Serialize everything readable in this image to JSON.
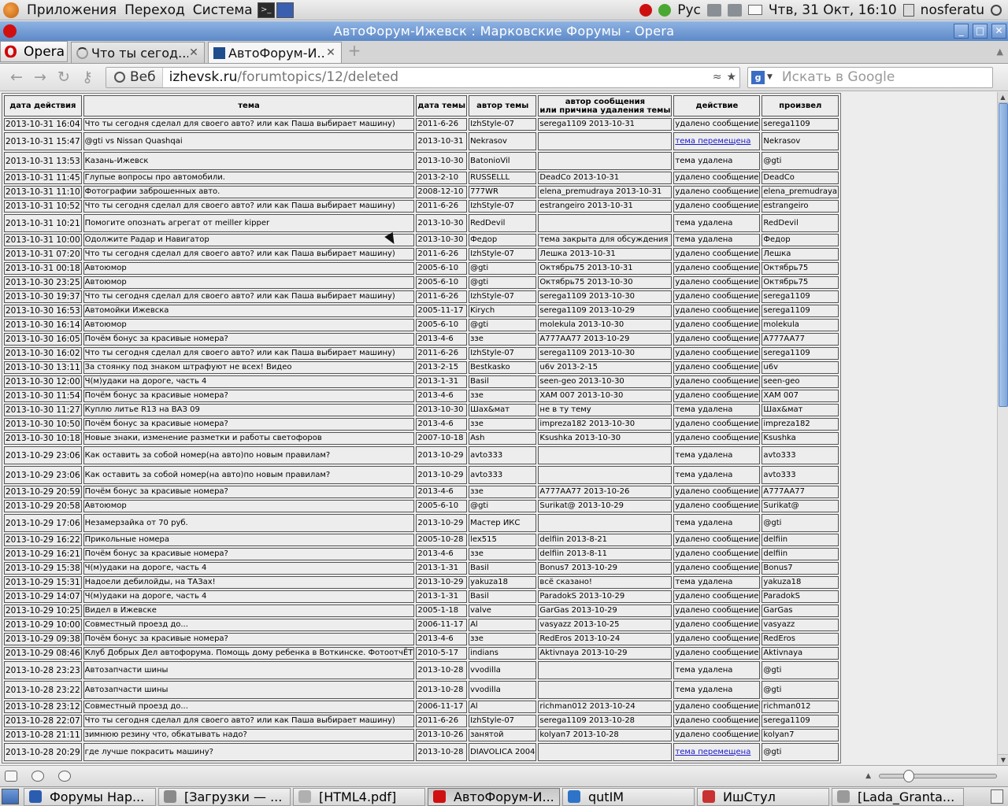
{
  "top_panel": {
    "menus": [
      "Приложения",
      "Переход",
      "Система"
    ],
    "keyboard_layout": "Рус",
    "clock": "Чтв, 31 Окт, 16:10",
    "user": "nosferatu"
  },
  "window": {
    "title": "АвтоФорум-Ижевск : Марковские Форумы - Opera"
  },
  "tabs": {
    "menu_label": "Opera",
    "items": [
      {
        "title": "Что ты сегод...",
        "icon": "loading-icon",
        "active": false
      },
      {
        "title": "АвтоФорум-И...",
        "icon": "forum-icon",
        "active": true
      }
    ]
  },
  "nav": {
    "web_label": "Веб",
    "url_host": "izhevsk.ru",
    "url_path": "/forumtopics/12/deleted",
    "search_placeholder": "Искать в Google"
  },
  "table": {
    "headers": [
      "дата действия",
      "тема",
      "дата темы",
      "автор темы",
      "автор сообщения\nили причина удаления темы",
      "действие",
      "произвел"
    ],
    "rows": [
      [
        "2013-10-31 16:04",
        "Что ты сегодня сделал для своего авто? или как Паша выбирает машину)",
        "2011-6-26",
        "IzhStyle-07",
        "serega1109 2013-10-31",
        "удалено сообщение",
        "serega1109"
      ],
      [
        "2013-10-31 15:47",
        "@gti vs Nissan Quashqai",
        "2013-10-31",
        "Nekrasov",
        "",
        "тема перемещена",
        "Nekrasov"
      ],
      [
        "2013-10-31 13:53",
        "Казань-Ижевск",
        "2013-10-30",
        "BatonioVil",
        "",
        "тема удалена",
        "@gti"
      ],
      [
        "2013-10-31 11:45",
        "Глупые вопросы про автомобили.",
        "2013-2-10",
        "RUSSELLL",
        "DeadCo 2013-10-31",
        "удалено сообщение",
        "DeadCo"
      ],
      [
        "2013-10-31 11:10",
        "Фотографии заброшенных авто.",
        "2008-12-10",
        "777WR",
        "elena_premudraya 2013-10-31",
        "удалено сообщение",
        "elena_premudraya"
      ],
      [
        "2013-10-31 10:52",
        "Что ты сегодня сделал для своего авто? или как Паша выбирает машину)",
        "2011-6-26",
        "IzhStyle-07",
        "estrangeiro 2013-10-31",
        "удалено сообщение",
        "estrangeiro"
      ],
      [
        "2013-10-31 10:21",
        "Помогите опознать агрегат от meiller kipper",
        "2013-10-30",
        "RedDevil",
        "",
        "тема удалена",
        "RedDevil"
      ],
      [
        "2013-10-31 10:00",
        "Одолжите Радар и Навигатор",
        "2013-10-30",
        "Федор",
        "тема закрыта для обсуждения",
        "тема удалена",
        "Федор"
      ],
      [
        "2013-10-31 07:20",
        "Что ты сегодня сделал для своего авто? или как Паша выбирает машину)",
        "2011-6-26",
        "IzhStyle-07",
        "Лешка 2013-10-31",
        "удалено сообщение",
        "Лешка"
      ],
      [
        "2013-10-31 00:18",
        "Автоюмор",
        "2005-6-10",
        "@gti",
        "Октябрь75 2013-10-31",
        "удалено сообщение",
        "Октябрь75"
      ],
      [
        "2013-10-30 23:25",
        "Автоюмор",
        "2005-6-10",
        "@gti",
        "Октябрь75 2013-10-30",
        "удалено сообщение",
        "Октябрь75"
      ],
      [
        "2013-10-30 19:37",
        "Что ты сегодня сделал для своего авто? или как Паша выбирает машину)",
        "2011-6-26",
        "IzhStyle-07",
        "serega1109 2013-10-30",
        "удалено сообщение",
        "serega1109"
      ],
      [
        "2013-10-30 16:53",
        "Автомойки Ижевска",
        "2005-11-17",
        "Kirych",
        "serega1109 2013-10-29",
        "удалено сообщение",
        "serega1109"
      ],
      [
        "2013-10-30 16:14",
        "Автоюмор",
        "2005-6-10",
        "@gti",
        "molekula 2013-10-30",
        "удалено сообщение",
        "molekula"
      ],
      [
        "2013-10-30 16:05",
        "Почём бонус за красивые номера?",
        "2013-4-6",
        "ззе",
        "A777AA77 2013-10-29",
        "удалено сообщение",
        "A777AA77"
      ],
      [
        "2013-10-30 16:02",
        "Что ты сегодня сделал для своего авто? или как Паша выбирает машину)",
        "2011-6-26",
        "IzhStyle-07",
        "serega1109 2013-10-30",
        "удалено сообщение",
        "serega1109"
      ],
      [
        "2013-10-30 13:11",
        "За стоянку под знаком штрафуют не всех! Видео",
        "2013-2-15",
        "Bestkasko",
        "u6v 2013-2-15",
        "удалено сообщение",
        "u6v"
      ],
      [
        "2013-10-30 12:00",
        "Ч(м)удаки на дороге, часть 4",
        "2013-1-31",
        "Basil",
        "seen-geo 2013-10-30",
        "удалено сообщение",
        "seen-geo"
      ],
      [
        "2013-10-30 11:54",
        "Почём бонус за красивые номера?",
        "2013-4-6",
        "ззе",
        "XAM 007 2013-10-30",
        "удалено сообщение",
        "XAM 007"
      ],
      [
        "2013-10-30 11:27",
        "Куплю литье R13 на ВАЗ 09",
        "2013-10-30",
        "Шах&мат",
        "не в ту тему",
        "тема удалена",
        "Шах&мат"
      ],
      [
        "2013-10-30 10:50",
        "Почём бонус за красивые номера?",
        "2013-4-6",
        "ззе",
        "impreza182 2013-10-30",
        "удалено сообщение",
        "impreza182"
      ],
      [
        "2013-10-30 10:18",
        "Новые знаки, изменение разметки и работы светофоров",
        "2007-10-18",
        "Ash",
        "Ksushka 2013-10-30",
        "удалено сообщение",
        "Ksushka"
      ],
      [
        "2013-10-29 23:06",
        "Как оставить за собой номер(на авто)по новым правилам?",
        "2013-10-29",
        "avto333",
        "",
        "тема удалена",
        "avto333"
      ],
      [
        "2013-10-29 23:06",
        "Как оставить за собой номер(на авто)по новым правилам?",
        "2013-10-29",
        "avto333",
        "",
        "тема удалена",
        "avto333"
      ],
      [
        "2013-10-29 20:59",
        "Почём бонус за красивые номера?",
        "2013-4-6",
        "ззе",
        "A777AA77 2013-10-26",
        "удалено сообщение",
        "A777AA77"
      ],
      [
        "2013-10-29 20:58",
        "Автоюмор",
        "2005-6-10",
        "@gti",
        "Surikat@ 2013-10-29",
        "удалено сообщение",
        "Surikat@"
      ],
      [
        "2013-10-29 17:06",
        "Незамерзайка от 70 руб.",
        "2013-10-29",
        "Мастер ИКС",
        "",
        "тема удалена",
        "@gti"
      ],
      [
        "2013-10-29 16:22",
        "Прикольные номера",
        "2005-10-28",
        "lex515",
        "delfiin 2013-8-21",
        "удалено сообщение",
        "delfiin"
      ],
      [
        "2013-10-29 16:21",
        "Почём бонус за красивые номера?",
        "2013-4-6",
        "ззе",
        "delfiin 2013-8-11",
        "удалено сообщение",
        "delfiin"
      ],
      [
        "2013-10-29 15:38",
        "Ч(м)удаки на дороге, часть 4",
        "2013-1-31",
        "Basil",
        "Bonus7 2013-10-29",
        "удалено сообщение",
        "Bonus7"
      ],
      [
        "2013-10-29 15:31",
        "Надоели дебилойды, на ТАЗах!",
        "2013-10-29",
        "yakuza18",
        "всё сказано!",
        "тема удалена",
        "yakuza18"
      ],
      [
        "2013-10-29 14:07",
        "Ч(м)удаки на дороге, часть 4",
        "2013-1-31",
        "Basil",
        "ParadokS 2013-10-29",
        "удалено сообщение",
        "ParadokS"
      ],
      [
        "2013-10-29 10:25",
        "Видел в Ижевске",
        "2005-1-18",
        "valve",
        "GarGas 2013-10-29",
        "удалено сообщение",
        "GarGas"
      ],
      [
        "2013-10-29 10:00",
        "Совместный проезд до...",
        "2006-11-17",
        "Al",
        "vasyazz 2013-10-25",
        "удалено сообщение",
        "vasyazz"
      ],
      [
        "2013-10-29 09:38",
        "Почём бонус за красивые номера?",
        "2013-4-6",
        "ззе",
        "RedEros 2013-10-24",
        "удалено сообщение",
        "RedEros"
      ],
      [
        "2013-10-29 08:46",
        "Клуб Добрых Дел автофорума. Помощь дому ребенка в Воткинске. ФотоотчЁТ",
        "2010-5-17",
        "indians",
        "Aktivnaya 2013-10-29",
        "удалено сообщение",
        "Aktivnaya"
      ],
      [
        "2013-10-28 23:23",
        "Автозапчасти шины",
        "2013-10-28",
        "vvodilla",
        "",
        "тема удалена",
        "@gti"
      ],
      [
        "2013-10-28 23:22",
        "Автозапчасти шины",
        "2013-10-28",
        "vvodilla",
        "",
        "тема удалена",
        "@gti"
      ],
      [
        "2013-10-28 23:12",
        "Совместный проезд до...",
        "2006-11-17",
        "Al",
        "richman012 2013-10-24",
        "удалено сообщение",
        "richman012"
      ],
      [
        "2013-10-28 22:07",
        "Что ты сегодня сделал для своего авто? или как Паша выбирает машину)",
        "2011-6-26",
        "IzhStyle-07",
        "serega1109 2013-10-28",
        "удалено сообщение",
        "serega1109"
      ],
      [
        "2013-10-28 21:11",
        "зимнюю резину что, обкатывать надо?",
        "2013-10-26",
        "занятой",
        "kolyan7 2013-10-28",
        "удалено сообщение",
        "kolyan7"
      ],
      [
        "2013-10-28 20:29",
        "где лучше покрасить машину?",
        "2013-10-28",
        "DIAVOLICA 2004",
        "",
        "тема перемещена",
        "@gti"
      ]
    ]
  },
  "taskbar": [
    {
      "title": "Форумы Нар...",
      "icon": "opera-icon",
      "color": "#2a5db0",
      "active": false
    },
    {
      "title": "[Загрузки — ...",
      "icon": "downloads-icon",
      "color": "#8a8a8a",
      "active": false
    },
    {
      "title": "[HTML4.pdf]",
      "icon": "pdf-icon",
      "color": "#b0b0b0",
      "active": false
    },
    {
      "title": "АвтоФорум-И...",
      "icon": "opera-icon",
      "color": "#d01010",
      "active": true
    },
    {
      "title": "qutIM",
      "icon": "qutim-icon",
      "color": "#2d74c8",
      "active": false
    },
    {
      "title": "ИшСтул",
      "icon": "chat-icon",
      "color": "#c83232",
      "active": false
    },
    {
      "title": "[Lada_Granta...",
      "icon": "document-icon",
      "color": "#9a9a9a",
      "active": false
    }
  ],
  "colors": {
    "title_bar": "#5d89c8",
    "link": "#1a1ac8",
    "opera_red": "#d01010"
  }
}
